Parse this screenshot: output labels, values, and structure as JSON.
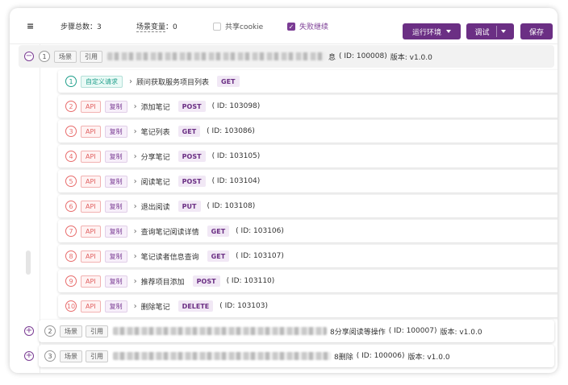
{
  "toolbar": {
    "menu_icon": "≡",
    "steps_label": "步骤总数：3",
    "vars_label": "场景变量",
    "vars_value": "：0",
    "share_cookie": "共享cookie",
    "fail_continue": "失败继续",
    "env_button": "运行环境",
    "debug_button": "调试",
    "save_button": "保存"
  },
  "scenarios": [
    {
      "index": "1",
      "tag": "场景",
      "ref": "引用",
      "name_tail": "息",
      "id_text": "( ID: 100008)",
      "version": "版本: v1.0.0",
      "toggle": "−"
    },
    {
      "index": "2",
      "tag": "场景",
      "ref": "引用",
      "name_tail": "8分享阅读等操作",
      "id_text": "( ID: 100007)",
      "version": "版本: v1.0.0",
      "toggle": "+"
    },
    {
      "index": "3",
      "tag": "场景",
      "ref": "引用",
      "name_tail": "8删除",
      "id_text": "( ID: 100006)",
      "version": "版本: v1.0.0",
      "toggle": "+"
    }
  ],
  "steps": [
    {
      "num": "1",
      "type": "自定义请求",
      "copy": "",
      "name": "顾问获取服务项目列表",
      "method": "GET",
      "id_text": ""
    },
    {
      "num": "2",
      "type": "API",
      "copy": "复制",
      "name": "添加笔记",
      "method": "POST",
      "id_text": "( ID: 103098)"
    },
    {
      "num": "3",
      "type": "API",
      "copy": "复制",
      "name": "笔记列表",
      "method": "GET",
      "id_text": "( ID: 103086)"
    },
    {
      "num": "4",
      "type": "API",
      "copy": "复制",
      "name": "分享笔记",
      "method": "POST",
      "id_text": "( ID: 103105)"
    },
    {
      "num": "5",
      "type": "API",
      "copy": "复制",
      "name": "阅读笔记",
      "method": "POST",
      "id_text": "( ID: 103104)"
    },
    {
      "num": "6",
      "type": "API",
      "copy": "复制",
      "name": "退出阅读",
      "method": "PUT",
      "id_text": "( ID: 103108)"
    },
    {
      "num": "7",
      "type": "API",
      "copy": "复制",
      "name": "查询笔记阅读详情",
      "method": "GET",
      "id_text": "( ID: 103106)"
    },
    {
      "num": "8",
      "type": "API",
      "copy": "复制",
      "name": "笔记读者信息查询",
      "method": "GET",
      "id_text": "( ID: 103107)"
    },
    {
      "num": "9",
      "type": "API",
      "copy": "复制",
      "name": "推荐项目添加",
      "method": "POST",
      "id_text": "( ID: 103110)"
    },
    {
      "num": "10",
      "type": "API",
      "copy": "复制",
      "name": "删除笔记",
      "method": "DELETE",
      "id_text": "( ID: 103103)"
    }
  ],
  "colors": {
    "accent": "#6b2f84",
    "api_red": "#e06060",
    "custom_green": "#1e9e8a"
  }
}
